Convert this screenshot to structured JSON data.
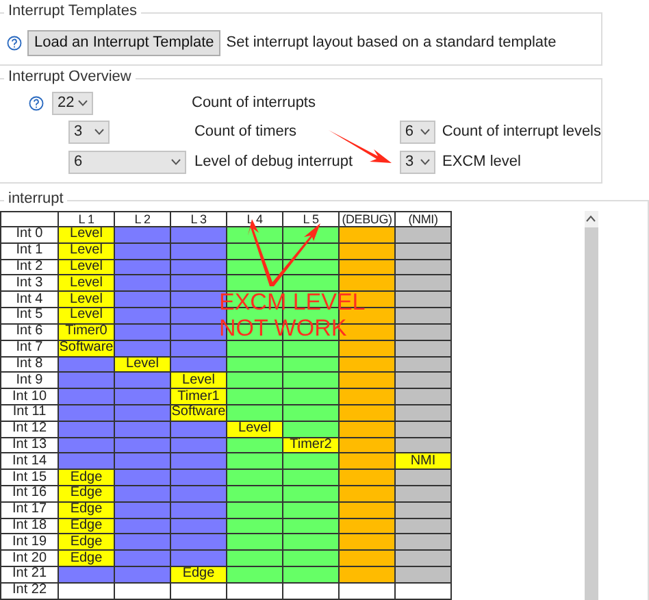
{
  "templates": {
    "title": "Interrupt Templates",
    "button": "Load an Interrupt Template",
    "description": "Set interrupt layout based on a standard template"
  },
  "overview": {
    "title": "Interrupt Overview",
    "fields": [
      {
        "value": "22",
        "label": "Count of interrupts",
        "kind": "short"
      },
      {
        "value": "3",
        "label": "Count of timers",
        "kind": "short"
      },
      {
        "value": "6",
        "label": "Count of interrupt levels",
        "kind": "right"
      },
      {
        "value": "6",
        "label": "Level of debug interrupt",
        "kind": "wide"
      },
      {
        "value": "3",
        "label": "EXCM level",
        "kind": "right"
      }
    ]
  },
  "interrupt": {
    "title": "interrupt",
    "columns": [
      {
        "label": "L 1",
        "color": "#7b7bff"
      },
      {
        "label": "L 2",
        "color": "#7b7bff"
      },
      {
        "label": "L 3",
        "color": "#7b7bff"
      },
      {
        "label": "L 4",
        "color": "#66ff66"
      },
      {
        "label": "L 5",
        "color": "#66ff66"
      },
      {
        "label": "(DEBUG)",
        "color": "#ffbb00"
      },
      {
        "label": "(NMI)",
        "color": "#c0c0c0"
      }
    ],
    "rows": [
      {
        "label": "Int 0",
        "cells": [
          {
            "kind": "tag",
            "text": "Level"
          },
          {
            "kind": "fill"
          },
          {
            "kind": "fill"
          },
          {
            "kind": "fill"
          },
          {
            "kind": "fill"
          },
          {
            "kind": "fill"
          },
          {
            "kind": "fill"
          }
        ]
      },
      {
        "label": "Int 1",
        "cells": [
          {
            "kind": "tag",
            "text": "Level"
          },
          {
            "kind": "fill"
          },
          {
            "kind": "fill"
          },
          {
            "kind": "fill"
          },
          {
            "kind": "fill"
          },
          {
            "kind": "fill"
          },
          {
            "kind": "fill"
          }
        ]
      },
      {
        "label": "Int 2",
        "cells": [
          {
            "kind": "tag",
            "text": "Level"
          },
          {
            "kind": "fill"
          },
          {
            "kind": "fill"
          },
          {
            "kind": "fill"
          },
          {
            "kind": "fill"
          },
          {
            "kind": "fill"
          },
          {
            "kind": "fill"
          }
        ]
      },
      {
        "label": "Int 3",
        "cells": [
          {
            "kind": "tag",
            "text": "Level"
          },
          {
            "kind": "fill"
          },
          {
            "kind": "fill"
          },
          {
            "kind": "fill"
          },
          {
            "kind": "fill"
          },
          {
            "kind": "fill"
          },
          {
            "kind": "fill"
          }
        ]
      },
      {
        "label": "Int 4",
        "cells": [
          {
            "kind": "tag",
            "text": "Level"
          },
          {
            "kind": "fill"
          },
          {
            "kind": "fill"
          },
          {
            "kind": "fill"
          },
          {
            "kind": "fill"
          },
          {
            "kind": "fill"
          },
          {
            "kind": "fill"
          }
        ]
      },
      {
        "label": "Int 5",
        "cells": [
          {
            "kind": "tag",
            "text": "Level"
          },
          {
            "kind": "fill"
          },
          {
            "kind": "fill"
          },
          {
            "kind": "fill"
          },
          {
            "kind": "fill"
          },
          {
            "kind": "fill"
          },
          {
            "kind": "fill"
          }
        ]
      },
      {
        "label": "Int 6",
        "cells": [
          {
            "kind": "tag",
            "text": "Timer0"
          },
          {
            "kind": "fill"
          },
          {
            "kind": "fill"
          },
          {
            "kind": "fill"
          },
          {
            "kind": "fill"
          },
          {
            "kind": "fill"
          },
          {
            "kind": "fill"
          }
        ]
      },
      {
        "label": "Int 7",
        "cells": [
          {
            "kind": "tag",
            "text": "Software"
          },
          {
            "kind": "fill"
          },
          {
            "kind": "fill"
          },
          {
            "kind": "fill"
          },
          {
            "kind": "fill"
          },
          {
            "kind": "fill"
          },
          {
            "kind": "fill"
          }
        ]
      },
      {
        "label": "Int 8",
        "cells": [
          {
            "kind": "fill"
          },
          {
            "kind": "tag",
            "text": "Level"
          },
          {
            "kind": "fill"
          },
          {
            "kind": "fill"
          },
          {
            "kind": "fill"
          },
          {
            "kind": "fill"
          },
          {
            "kind": "fill"
          }
        ]
      },
      {
        "label": "Int 9",
        "cells": [
          {
            "kind": "fill"
          },
          {
            "kind": "fill"
          },
          {
            "kind": "tag",
            "text": "Level"
          },
          {
            "kind": "fill"
          },
          {
            "kind": "fill"
          },
          {
            "kind": "fill"
          },
          {
            "kind": "fill"
          }
        ]
      },
      {
        "label": "Int 10",
        "cells": [
          {
            "kind": "fill"
          },
          {
            "kind": "fill"
          },
          {
            "kind": "tag",
            "text": "Timer1"
          },
          {
            "kind": "fill"
          },
          {
            "kind": "fill"
          },
          {
            "kind": "fill"
          },
          {
            "kind": "fill"
          }
        ]
      },
      {
        "label": "Int 11",
        "cells": [
          {
            "kind": "fill"
          },
          {
            "kind": "fill"
          },
          {
            "kind": "tag",
            "text": "Software"
          },
          {
            "kind": "fill"
          },
          {
            "kind": "fill"
          },
          {
            "kind": "fill"
          },
          {
            "kind": "fill"
          }
        ]
      },
      {
        "label": "Int 12",
        "cells": [
          {
            "kind": "fill"
          },
          {
            "kind": "fill"
          },
          {
            "kind": "fill"
          },
          {
            "kind": "tag",
            "text": "Level"
          },
          {
            "kind": "fill"
          },
          {
            "kind": "fill"
          },
          {
            "kind": "fill"
          }
        ]
      },
      {
        "label": "Int 13",
        "cells": [
          {
            "kind": "fill"
          },
          {
            "kind": "fill"
          },
          {
            "kind": "fill"
          },
          {
            "kind": "fill"
          },
          {
            "kind": "tag",
            "text": "Timer2"
          },
          {
            "kind": "fill"
          },
          {
            "kind": "fill"
          }
        ]
      },
      {
        "label": "Int 14",
        "cells": [
          {
            "kind": "fill"
          },
          {
            "kind": "fill"
          },
          {
            "kind": "fill"
          },
          {
            "kind": "fill"
          },
          {
            "kind": "fill"
          },
          {
            "kind": "fill"
          },
          {
            "kind": "tag",
            "text": "NMI"
          }
        ]
      },
      {
        "label": "Int 15",
        "cells": [
          {
            "kind": "tag",
            "text": "Edge"
          },
          {
            "kind": "fill"
          },
          {
            "kind": "fill"
          },
          {
            "kind": "fill"
          },
          {
            "kind": "fill"
          },
          {
            "kind": "fill"
          },
          {
            "kind": "fill"
          }
        ]
      },
      {
        "label": "Int 16",
        "cells": [
          {
            "kind": "tag",
            "text": "Edge"
          },
          {
            "kind": "fill"
          },
          {
            "kind": "fill"
          },
          {
            "kind": "fill"
          },
          {
            "kind": "fill"
          },
          {
            "kind": "fill"
          },
          {
            "kind": "fill"
          }
        ]
      },
      {
        "label": "Int 17",
        "cells": [
          {
            "kind": "tag",
            "text": "Edge"
          },
          {
            "kind": "fill"
          },
          {
            "kind": "fill"
          },
          {
            "kind": "fill"
          },
          {
            "kind": "fill"
          },
          {
            "kind": "fill"
          },
          {
            "kind": "fill"
          }
        ]
      },
      {
        "label": "Int 18",
        "cells": [
          {
            "kind": "tag",
            "text": "Edge"
          },
          {
            "kind": "fill"
          },
          {
            "kind": "fill"
          },
          {
            "kind": "fill"
          },
          {
            "kind": "fill"
          },
          {
            "kind": "fill"
          },
          {
            "kind": "fill"
          }
        ]
      },
      {
        "label": "Int 19",
        "cells": [
          {
            "kind": "tag",
            "text": "Edge"
          },
          {
            "kind": "fill"
          },
          {
            "kind": "fill"
          },
          {
            "kind": "fill"
          },
          {
            "kind": "fill"
          },
          {
            "kind": "fill"
          },
          {
            "kind": "fill"
          }
        ]
      },
      {
        "label": "Int 20",
        "cells": [
          {
            "kind": "tag",
            "text": "Edge"
          },
          {
            "kind": "fill"
          },
          {
            "kind": "fill"
          },
          {
            "kind": "fill"
          },
          {
            "kind": "fill"
          },
          {
            "kind": "fill"
          },
          {
            "kind": "fill"
          }
        ]
      },
      {
        "label": "Int 21",
        "cells": [
          {
            "kind": "fill"
          },
          {
            "kind": "fill"
          },
          {
            "kind": "tag",
            "text": "Edge"
          },
          {
            "kind": "fill"
          },
          {
            "kind": "fill"
          },
          {
            "kind": "fill"
          },
          {
            "kind": "fill"
          }
        ]
      },
      {
        "label": "Int 22",
        "cells": [
          {
            "kind": "empty"
          },
          {
            "kind": "empty"
          },
          {
            "kind": "empty"
          },
          {
            "kind": "empty"
          },
          {
            "kind": "empty"
          },
          {
            "kind": "empty"
          },
          {
            "kind": "empty"
          }
        ]
      }
    ],
    "annotation": [
      "EXCM LEVEL",
      "NOT WORK"
    ]
  }
}
